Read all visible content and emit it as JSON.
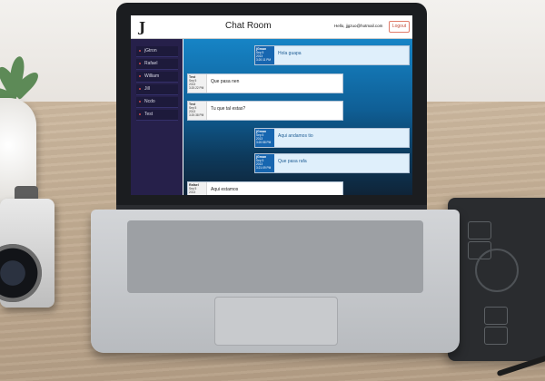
{
  "chat_app": {
    "logo": "J",
    "title": "Chat Room",
    "hello_text": "Hello, jjgzuo@hotmail.com",
    "logout_label": "Logout",
    "users": [
      {
        "name": "jGtron"
      },
      {
        "name": "Rafael"
      },
      {
        "name": "William"
      },
      {
        "name": "Jill"
      },
      {
        "name": "Ncdo"
      },
      {
        "name": "Test"
      }
    ],
    "messages": [
      {
        "author": "jGman",
        "date_line1": "Sep 5",
        "date_line2": "2013",
        "time": "3:20:11 PM",
        "text": "Hola guapa",
        "mine": true
      },
      {
        "author": "Test",
        "date_line1": "Sep 5",
        "date_line2": "2013",
        "time": "3:20:22 PM",
        "text": "Que pasa nen",
        "mine": false
      },
      {
        "author": "Test",
        "date_line1": "Sep 5",
        "date_line2": "2013",
        "time": "3:20:38 PM",
        "text": "Tu que tal estas?",
        "mine": false
      },
      {
        "author": "jGman",
        "date_line1": "Sep 5",
        "date_line2": "2013",
        "time": "3:20:58 PM",
        "text": "Aqui andamos tio",
        "mine": true
      },
      {
        "author": "jGman",
        "date_line1": "Sep 5",
        "date_line2": "2013",
        "time": "3:21:09 PM",
        "text": "Que pasa rafa",
        "mine": true
      },
      {
        "author": "Rafael",
        "date_line1": "Sep 5",
        "date_line2": "2013",
        "time": "",
        "text": "Aqui estamos",
        "mine": false
      }
    ]
  },
  "colors": {
    "sidebar": "#26204a",
    "chat_top": "#1684c6",
    "chat_bottom": "#0f2438",
    "own_meta": "#1766b0",
    "logout_border": "#e07c6a"
  }
}
